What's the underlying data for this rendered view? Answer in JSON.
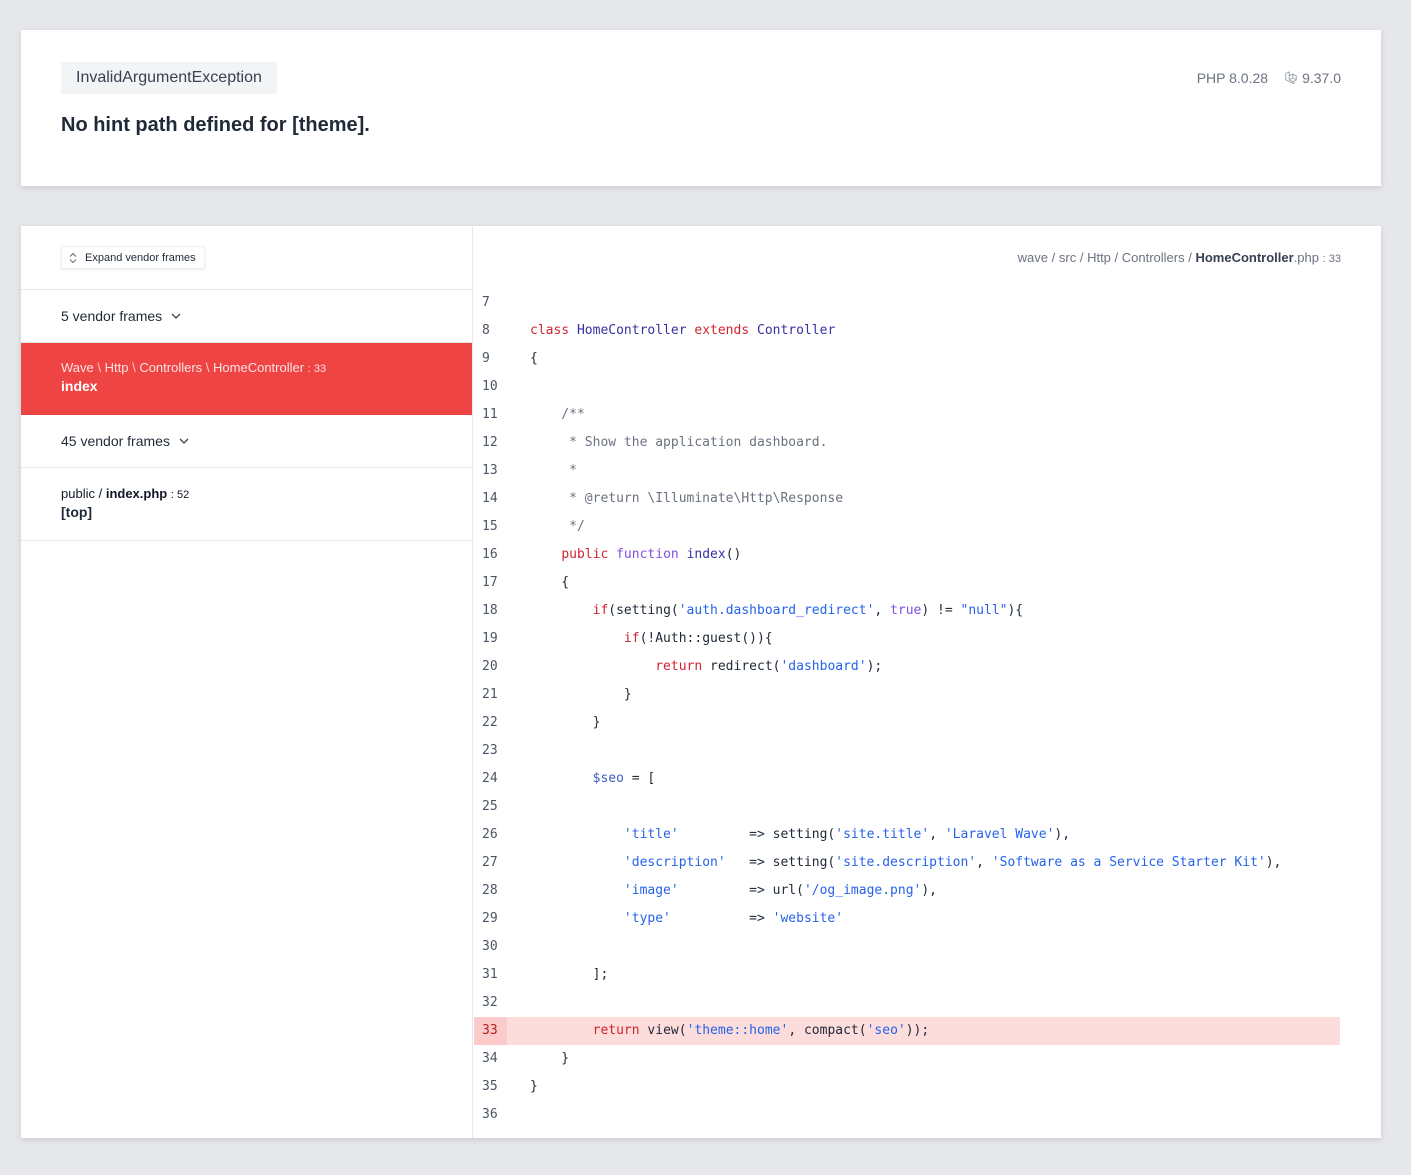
{
  "header": {
    "exception_class": "InvalidArgumentException",
    "message": "No hint path defined for [theme].",
    "php_version": "PHP 8.0.28",
    "laravel_version": "9.37.0"
  },
  "sidebar": {
    "expand_label": "Expand vendor frames",
    "frames": [
      {
        "type": "vendor",
        "label": "5 vendor frames"
      },
      {
        "type": "active",
        "path": [
          "Wave",
          "Http",
          "Controllers",
          "HomeController"
        ],
        "line": "33",
        "method": "index"
      },
      {
        "type": "vendor",
        "label": "45 vendor frames"
      },
      {
        "type": "app",
        "path": [
          "public",
          "index.php"
        ],
        "line": "52",
        "method": "[top]"
      }
    ]
  },
  "code_pane": {
    "breadcrumb": [
      "wave",
      "src",
      "Http",
      "Controllers"
    ],
    "file": "HomeController",
    "ext": ".php",
    "line": "33",
    "highlight_line": 33,
    "lines": [
      {
        "n": "7",
        "src": ""
      },
      {
        "n": "8",
        "src": "class HomeController extends Controller"
      },
      {
        "n": "9",
        "src": "{"
      },
      {
        "n": "10",
        "src": ""
      },
      {
        "n": "11",
        "src": "    /**"
      },
      {
        "n": "12",
        "src": "     * Show the application dashboard."
      },
      {
        "n": "13",
        "src": "     *"
      },
      {
        "n": "14",
        "src": "     * @return \\Illuminate\\Http\\Response"
      },
      {
        "n": "15",
        "src": "     */"
      },
      {
        "n": "16",
        "src": "    public function index()"
      },
      {
        "n": "17",
        "src": "    {"
      },
      {
        "n": "18",
        "src": "        if(setting('auth.dashboard_redirect', true) != \"null\"){"
      },
      {
        "n": "19",
        "src": "            if(!Auth::guest()){"
      },
      {
        "n": "20",
        "src": "                return redirect('dashboard');"
      },
      {
        "n": "21",
        "src": "            }"
      },
      {
        "n": "22",
        "src": "        }"
      },
      {
        "n": "23",
        "src": ""
      },
      {
        "n": "24",
        "src": "        $seo = ["
      },
      {
        "n": "25",
        "src": ""
      },
      {
        "n": "26",
        "src": "            'title'         => setting('site.title', 'Laravel Wave'),"
      },
      {
        "n": "27",
        "src": "            'description'   => setting('site.description', 'Software as a Service Starter Kit'),"
      },
      {
        "n": "28",
        "src": "            'image'         => url('/og_image.png'),"
      },
      {
        "n": "29",
        "src": "            'type'          => 'website'"
      },
      {
        "n": "30",
        "src": ""
      },
      {
        "n": "31",
        "src": "        ];"
      },
      {
        "n": "32",
        "src": ""
      },
      {
        "n": "33",
        "src": "        return view('theme::home', compact('seo'));"
      },
      {
        "n": "34",
        "src": "    }"
      },
      {
        "n": "35",
        "src": "}"
      },
      {
        "n": "36",
        "src": ""
      }
    ]
  }
}
